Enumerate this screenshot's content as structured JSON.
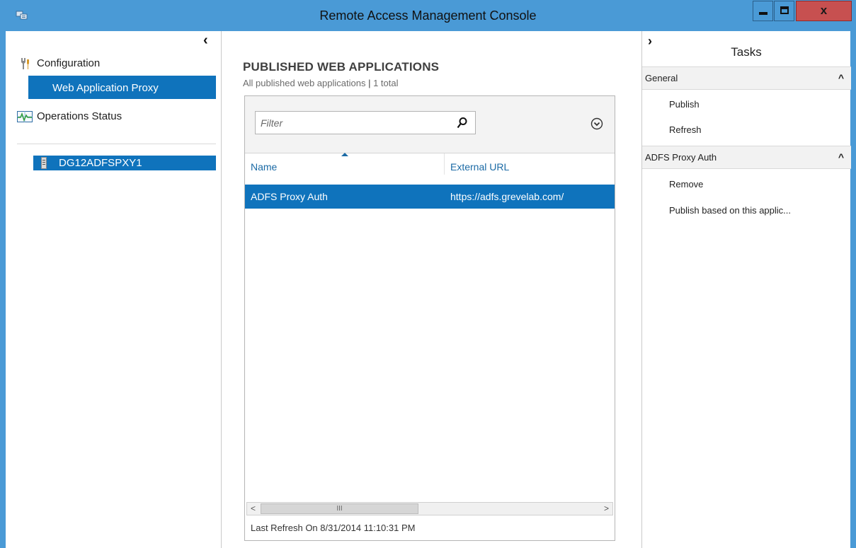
{
  "window": {
    "title": "Remote Access Management Console",
    "accent_color": "#4a9ad6",
    "close_color": "#c75050",
    "close_glyph": "x"
  },
  "nav": {
    "collapse_glyph": "‹",
    "configuration": {
      "label": "Configuration",
      "icon": "tools-icon"
    },
    "web_application_proxy": {
      "label": "Web Application Proxy",
      "selected": true
    },
    "operations_status": {
      "label": "Operations Status",
      "icon": "monitor-icon"
    },
    "server": {
      "label": "DG12ADFSPXY1",
      "icon": "server-icon",
      "selected": true
    },
    "selection_color": "#0f73bc"
  },
  "main": {
    "title": "PUBLISHED WEB APPLICATIONS",
    "subtitle_left": "All published web applications",
    "subtitle_sep": "|",
    "subtitle_count": "1 total",
    "filter": {
      "placeholder": "Filter",
      "value": ""
    },
    "columns": [
      {
        "label": "Name",
        "sorted": "ascending"
      },
      {
        "label": "External URL"
      }
    ],
    "rows": [
      {
        "name": "ADFS Proxy Auth",
        "external_url": "https://adfs.grevelab.com/",
        "selected": true
      }
    ],
    "scrollbar": {
      "left": "<",
      "right": ">",
      "grip": "III"
    },
    "last_refresh": "Last Refresh On 8/31/2014 11:10:31 PM"
  },
  "tasks": {
    "expand_glyph": "›",
    "title": "Tasks",
    "groups": [
      {
        "label": "General",
        "items": [
          "Publish",
          "Refresh"
        ]
      },
      {
        "label": "ADFS Proxy Auth",
        "items": [
          "Remove",
          "Publish based on this applic..."
        ]
      }
    ],
    "collapse_chevron": "^"
  }
}
